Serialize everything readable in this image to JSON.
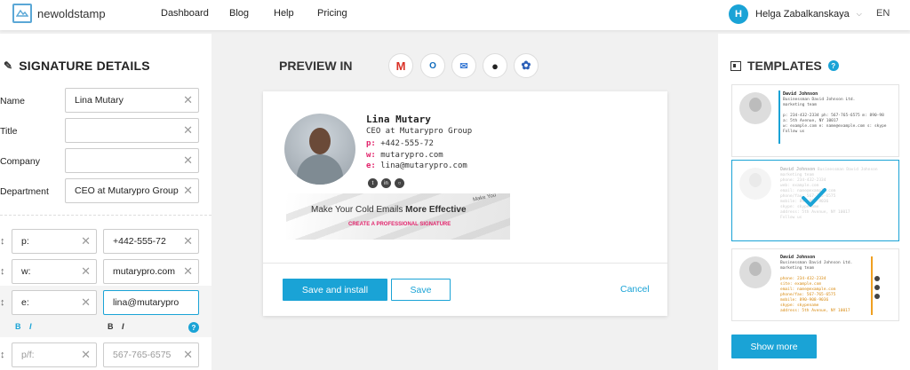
{
  "brand": {
    "name": "newoldstamp"
  },
  "nav": [
    "Dashboard",
    "Blog",
    "Help",
    "Pricing"
  ],
  "user": {
    "initial": "H",
    "name": "Helga Zabalkanskaya",
    "lang": "EN"
  },
  "details": {
    "title": "SIGNATURE DETAILS",
    "fields": [
      {
        "label": "Name",
        "value": "Lina Mutary"
      },
      {
        "label": "Title",
        "value": ""
      },
      {
        "label": "Company",
        "value": ""
      },
      {
        "label": "Department",
        "value": "CEO at Mutarypro Group"
      }
    ],
    "contacts": [
      {
        "prefix": "p:",
        "value": "+442-555-72"
      },
      {
        "prefix": "w:",
        "value": "mutarypro.com"
      },
      {
        "prefix": "e:",
        "value": "lina@mutarypro"
      },
      {
        "prefix": "",
        "prefix_placeholder": "p/f:",
        "value": "",
        "value_placeholder": "567-765-6575"
      }
    ],
    "bold_label": "B",
    "italic_label": "I",
    "help_label": "?"
  },
  "preview": {
    "title": "PREVIEW IN",
    "clients": [
      "gmail-icon",
      "outlook-icon",
      "apple-mail-icon",
      "apple-icon",
      "thunderbird-icon"
    ],
    "signature": {
      "name": "Lina Mutary",
      "position": "CEO at Mutarypro Group",
      "phone_key": "p:",
      "phone": "+442-555-72",
      "web_key": "w:",
      "web": "mutarypro.com",
      "email_key": "e:",
      "email": "lina@mutarypro.com",
      "banner_text_a": "Make Your Cold Emails ",
      "banner_text_b": "More Effective",
      "banner_cta": "CREATE A PROFESSIONAL SIGNATURE",
      "banner_side": "Make You"
    },
    "buttons": {
      "save_install": "Save and install",
      "save": "Save",
      "cancel": "Cancel"
    }
  },
  "templates": {
    "title": "TEMPLATES",
    "help_label": "?",
    "show_more": "Show more",
    "cards": [
      {
        "name": "David Johnson",
        "role": "Businessman David Johnson Ltd.",
        "dept": "marketing team",
        "lines": [
          "p: 234-432-2334 ph: 567-765-6575 m: 890-98",
          "a: 5th Avenue, NY 10017",
          "w: example.com e: name@example.com s: skype"
        ],
        "follow": "Follow us"
      },
      {
        "name": "David Johnson",
        "role": "Businessman David Johnson",
        "dept": "marketing team",
        "lines": [
          "phone: 234-432-2334",
          "web: example.com",
          "email: name@example.com",
          "phone/fax: 567-765-6575",
          "mobile: 890-908-9036",
          "skype: skypename",
          "address: 5th Avenue, NY 10017"
        ],
        "follow": "Follow us"
      },
      {
        "name": "David Johnson",
        "role": "Businessman David Johnson Ltd.",
        "dept": "marketing team",
        "lines": [
          "phone: 234-432-2334",
          "site: example.com",
          "email: name@example.com",
          "phone/fax: 567-765-6575",
          "mobile: 890-908-9036",
          "skype: skypename",
          "address: 5th Avenue, NY 10017"
        ]
      }
    ]
  },
  "colors": {
    "accent": "#1aa3d6",
    "signature_key": "#e2246c",
    "template_orange": "#f0a020"
  }
}
